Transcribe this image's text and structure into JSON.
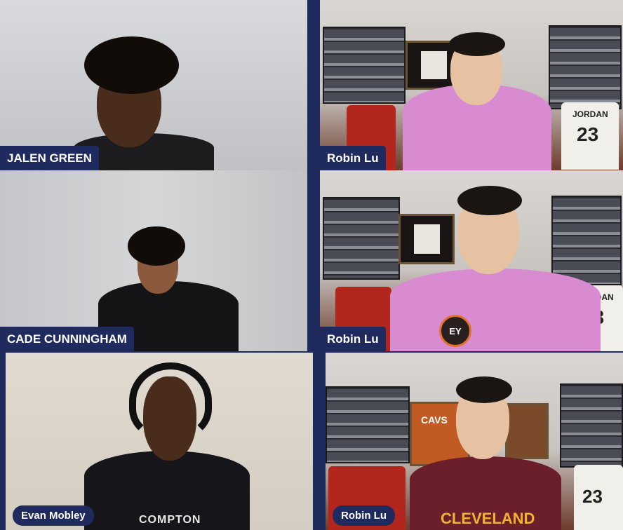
{
  "participants": [
    {
      "name": "JALEN GREEN"
    },
    {
      "name": "Robin Lu"
    },
    {
      "name": "CADE CUNNINGHAM"
    },
    {
      "name": "Robin Lu"
    },
    {
      "name": "Evan Mobley"
    },
    {
      "name": "Robin Lu"
    }
  ],
  "background_text": {
    "jersey_number": "23",
    "jersey_name": "JORDAN",
    "shirt_text": "CLEVELAND",
    "shirt_text_2": "COMPTON",
    "badge": "EY",
    "cavs_jersey": "CAVS"
  },
  "colors": {
    "frame_bg": "#1e2a5c",
    "label_bg": "#1f2b5e",
    "hoodie_pink": "#d98bd1"
  }
}
